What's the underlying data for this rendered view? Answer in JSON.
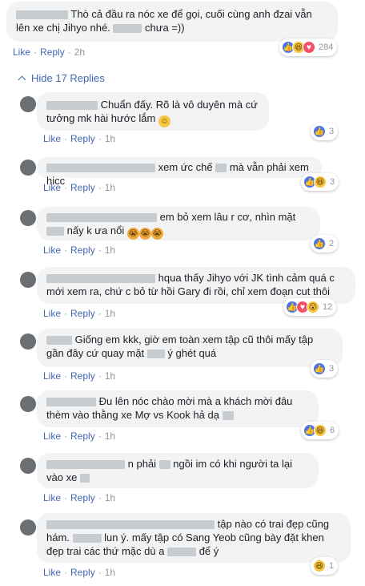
{
  "comment_top": {
    "text_a": "Thò cả đầu ra nóc xe để gọi, cuối cùng anh đzai vẫn lên xe chị Jihyo nhé.",
    "text_b": "chưa =))",
    "like": "Like",
    "reply": "Reply",
    "time": "2h",
    "reaction_count": "284",
    "reactions": [
      "like-icon",
      "haha-icon",
      "love-icon"
    ]
  },
  "hide_replies_label": "Hide 17 Replies",
  "replies": [
    {
      "text": "Chuẩn đấy. Rõ là vô duyên mà cứ tưởng mk hài hước lắm",
      "emoji": "smile",
      "like": "Like",
      "reply": "Reply",
      "time": "1h",
      "reaction_count": "3",
      "reactions": [
        "like-icon"
      ]
    },
    {
      "text_a": "xem ức chế",
      "text_b": "mà vẫn phải xem hicc",
      "like": "Like",
      "reply": "Reply",
      "time": "1h",
      "reaction_count": "3",
      "reactions": [
        "like-icon",
        "haha-icon"
      ]
    },
    {
      "text_a": "em bỏ xem lâu r cơ, nhìn mặt",
      "text_b": "nấy k ưa nổi",
      "emoji": "cry x3",
      "like": "Like",
      "reply": "Reply",
      "time": "1h",
      "reaction_count": "2",
      "reactions": [
        "like-icon"
      ]
    },
    {
      "text": "hqua thấy Jihyo với JK tình cảm quá c mới xem ra, chứ c bỏ từ hồi Gary đi rồi, chỉ xem đoạn cut thôi",
      "like": "Like",
      "reply": "Reply",
      "time": "1h",
      "reaction_count": "12",
      "reactions": [
        "like-icon",
        "love-icon",
        "wow-icon"
      ]
    },
    {
      "text_a": "Giống em kkk, giờ em toàn xem tập cũ thôi mấy tập gần đây cứ quay mặt",
      "text_b": "ý ghét quá",
      "like": "Like",
      "reply": "Reply",
      "time": "1h",
      "reaction_count": "3",
      "reactions": [
        "like-icon"
      ]
    },
    {
      "text": "Đu lên nóc chào mời mà a khách mời đâu thèm vào thằng xe Mợ vs Kook hả dạ",
      "like": "Like",
      "reply": "Reply",
      "time": "1h",
      "reaction_count": "6",
      "reactions": [
        "like-icon",
        "haha-icon"
      ]
    },
    {
      "text_a": "n phải",
      "text_b": "ngồi im có khi người ta lại vào xe",
      "like": "Like",
      "reply": "Reply",
      "time": "1h"
    },
    {
      "text_a": "tập nào có trai đẹp cũng hám.",
      "text_b": "lun ý. mấy tập có Sang Yeob cũng bày đặt khen đẹp trai các thứ mặc dù a",
      "text_c": "để ý",
      "like": "Like",
      "reply": "Reply",
      "time": "1h",
      "reaction_count": "1",
      "reactions": [
        "haha-icon"
      ]
    }
  ],
  "colors": {
    "link": "#4267b2",
    "bubble": "#f2f3f5",
    "meta": "#90949c",
    "like_blue": "#4a76e8"
  }
}
